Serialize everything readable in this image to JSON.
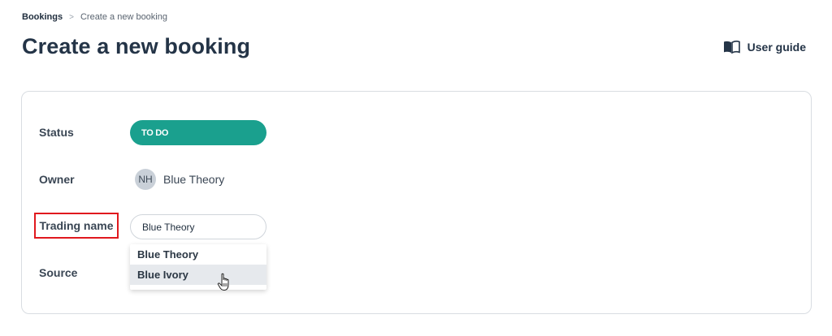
{
  "breadcrumb": {
    "root": "Bookings",
    "separator": ">",
    "current": "Create a new booking"
  },
  "page": {
    "title": "Create a new booking"
  },
  "header": {
    "user_guide_label": "User guide",
    "user_guide_icon": "book-icon"
  },
  "form": {
    "status": {
      "label": "Status",
      "value": "TO DO",
      "color": "#1aa08e"
    },
    "owner": {
      "label": "Owner",
      "initials": "NH",
      "name": "Blue Theory"
    },
    "trading_name": {
      "label": "Trading name",
      "value": "Blue Theory",
      "options": [
        "Blue Theory",
        "Blue Ivory"
      ],
      "highlighted_option": "Blue Ivory"
    },
    "source": {
      "label": "Source"
    }
  },
  "colors": {
    "accent": "#1aa08e",
    "highlight_box": "#e0191e"
  }
}
